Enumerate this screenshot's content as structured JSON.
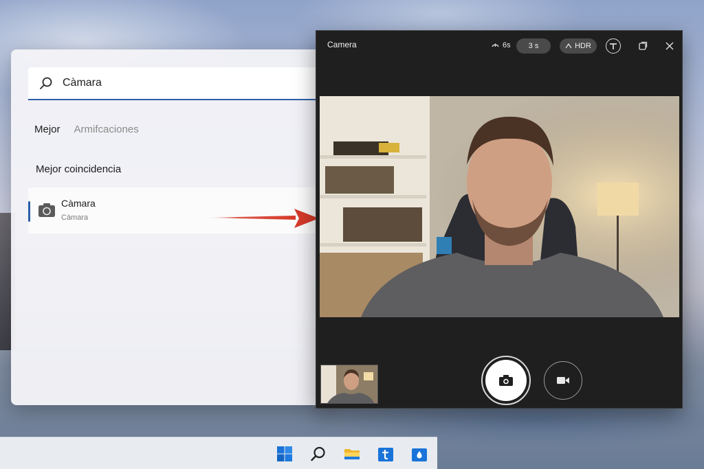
{
  "search_panel": {
    "query": "Càmara",
    "tabs": [
      {
        "label": "Mejor"
      },
      {
        "label": "Armifcaciones"
      }
    ],
    "section_title": "Mejor coincidencia",
    "best_match": {
      "title": "Càmara",
      "subtitle": "Càmara",
      "icon": "camera-app-icon"
    }
  },
  "camera_window": {
    "title": "Camera",
    "timer_label": "6s",
    "delay_pill": "3 s",
    "hdr_label": "HDR",
    "controls": {
      "photo": "camera-icon",
      "video": "video-icon",
      "settings": "adjust-icon",
      "restore": "restore-icon",
      "close": "close-icon"
    }
  },
  "taskbar": {
    "items": [
      "windows-start-icon",
      "search-icon",
      "file-explorer-icon",
      "store-icon",
      "app-icon"
    ]
  },
  "colors": {
    "accent": "#2b5fa8",
    "arrow": "#d63a2a",
    "camera_bg": "#1f1f1f"
  }
}
